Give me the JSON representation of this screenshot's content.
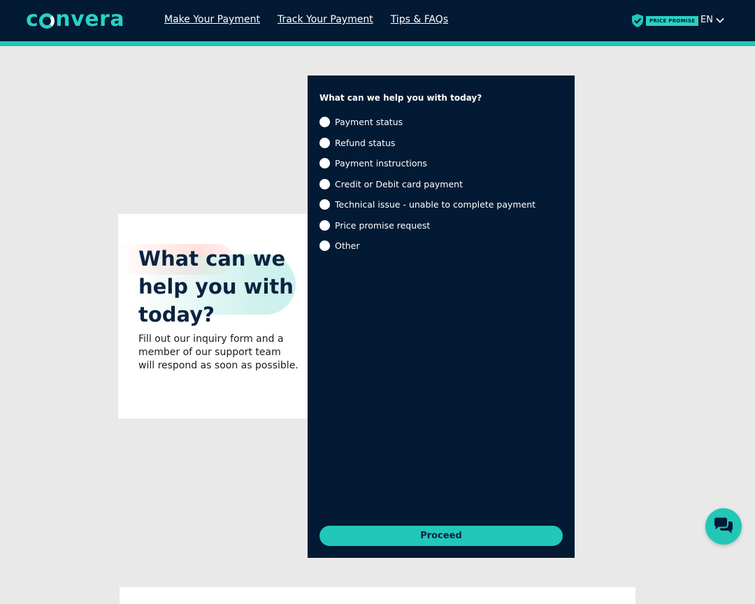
{
  "header": {
    "logo_text_left": "c",
    "logo_text_right": "nvera",
    "nav": [
      {
        "label": "Make Your Payment"
      },
      {
        "label": "Track Your Payment"
      },
      {
        "label": "Tips & FAQs"
      }
    ],
    "price_promise_label": "PRICE PROMISE",
    "language": "EN",
    "colors": {
      "background": "#021a33",
      "accent": "#22c7b8"
    }
  },
  "intro": {
    "title": "What can we help you with today?",
    "description": "Fill out our inquiry form and a member of our support team will respond as soon as possible."
  },
  "form": {
    "question": "What can we help you with today?",
    "options": [
      {
        "label": "Payment status"
      },
      {
        "label": "Refund status"
      },
      {
        "label": "Payment instructions"
      },
      {
        "label": "Credit or Debit card payment"
      },
      {
        "label": "Technical issue - unable to complete payment"
      },
      {
        "label": "Price promise request"
      },
      {
        "label": "Other"
      }
    ],
    "proceed_label": "Proceed"
  },
  "chat": {
    "icon": "chat-bubbles-icon"
  }
}
